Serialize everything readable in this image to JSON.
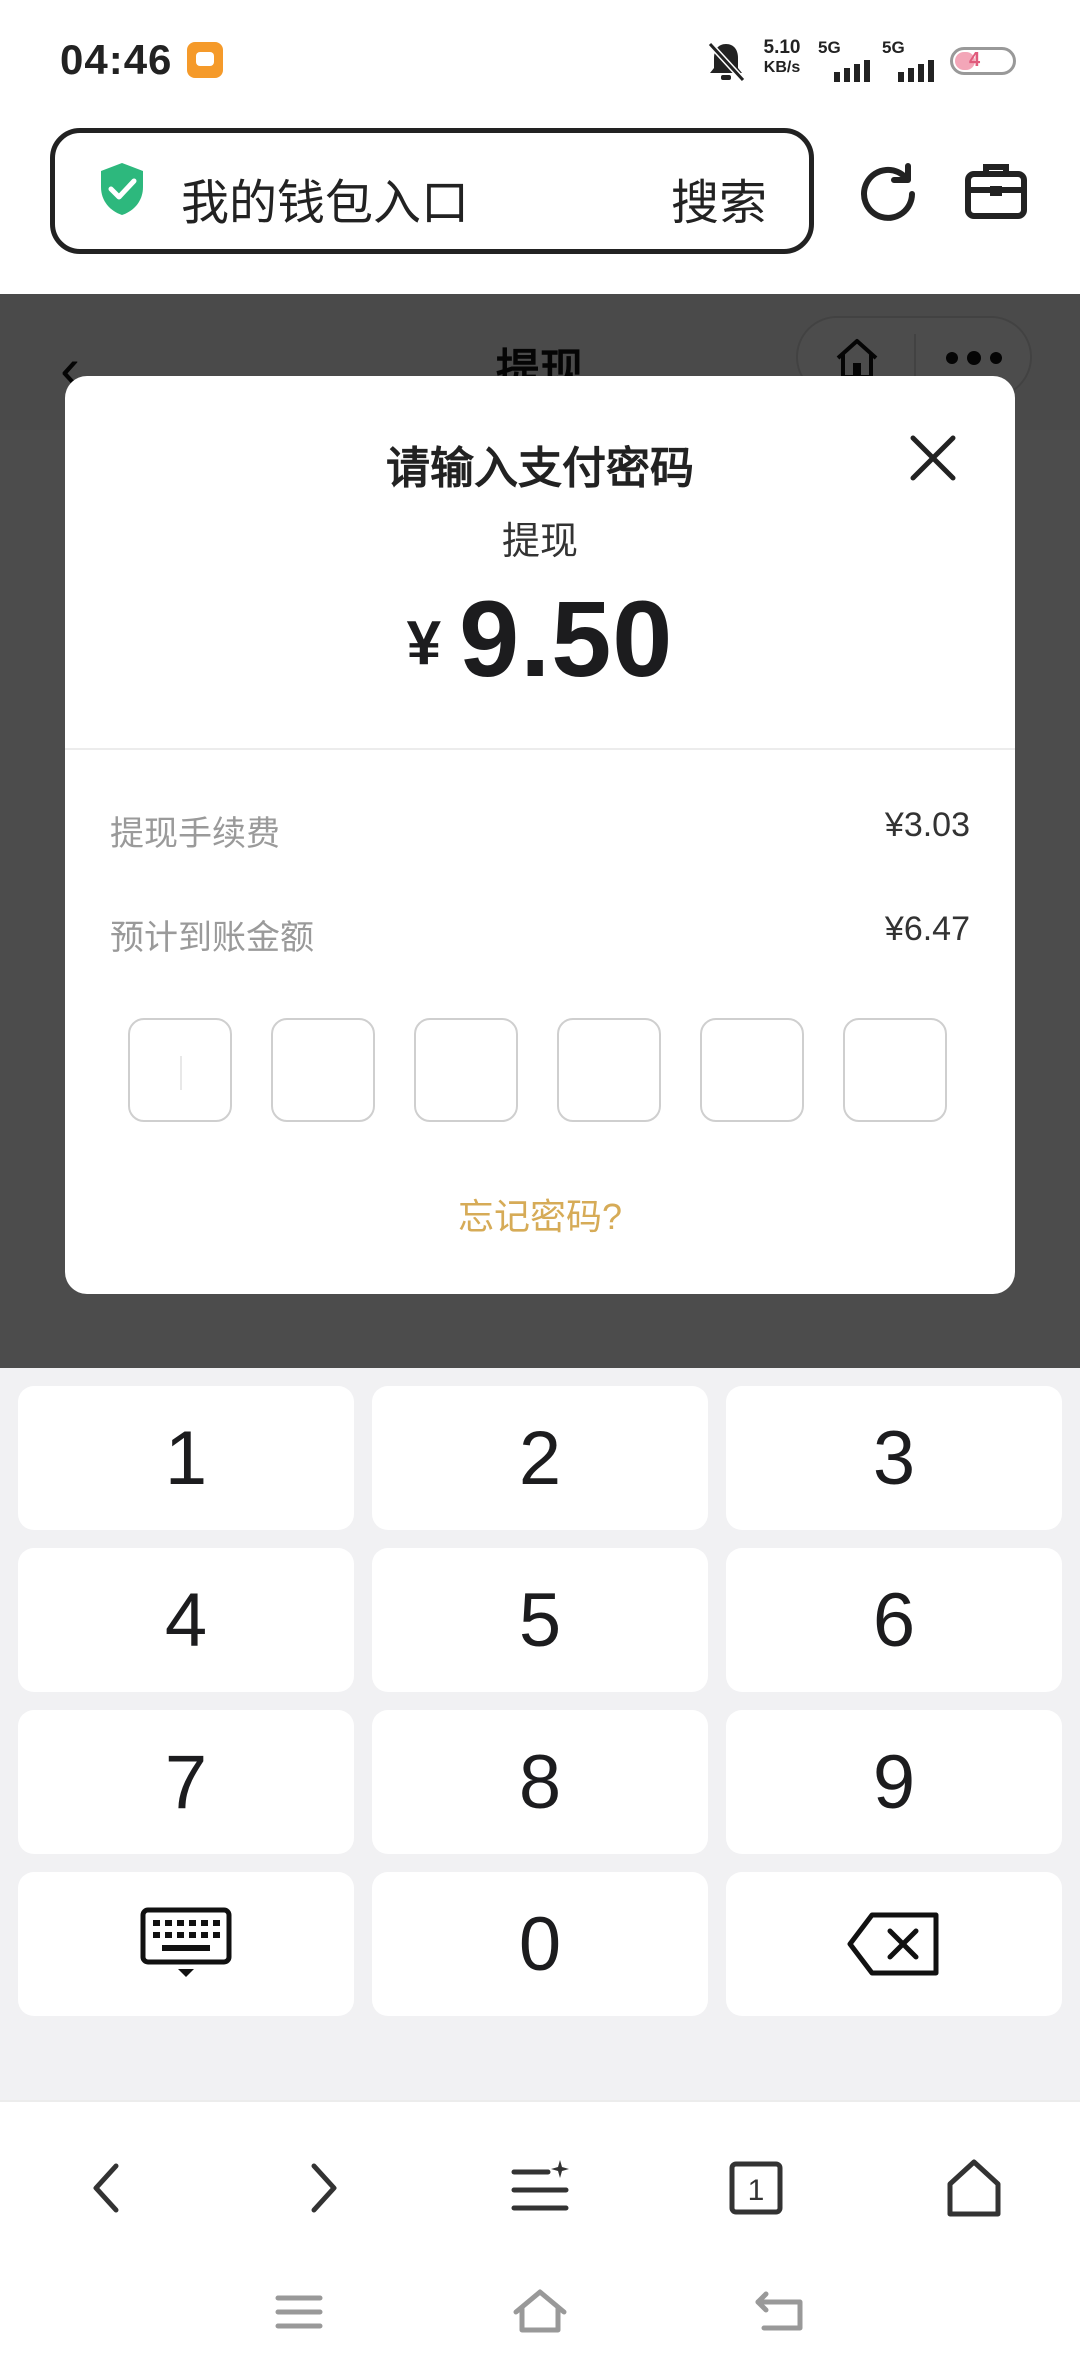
{
  "status_bar": {
    "time": "04:46",
    "net_speed_value": "5.10",
    "net_speed_unit": "KB/s",
    "sim1_label": "5G",
    "sim2_label": "5G",
    "battery_level": "4"
  },
  "browser": {
    "address_title": "我的钱包入口",
    "search_label": "搜索"
  },
  "page": {
    "title": "提现"
  },
  "modal": {
    "title": "请输入支付密码",
    "subtitle": "提现",
    "currency": "¥",
    "amount": "9.50",
    "fee_label": "提现手续费",
    "fee_value": "¥3.03",
    "expected_label": "预计到账金额",
    "expected_value": "¥6.47",
    "password_length": 6,
    "forgot_label": "忘记密码?"
  },
  "keypad": {
    "digits": [
      "1",
      "2",
      "3",
      "4",
      "5",
      "6",
      "7",
      "8",
      "9",
      "0"
    ]
  },
  "colors": {
    "accent_gold": "#d6ab57",
    "shield_green": "#2db87d",
    "overlay": "#4a4a4a"
  }
}
